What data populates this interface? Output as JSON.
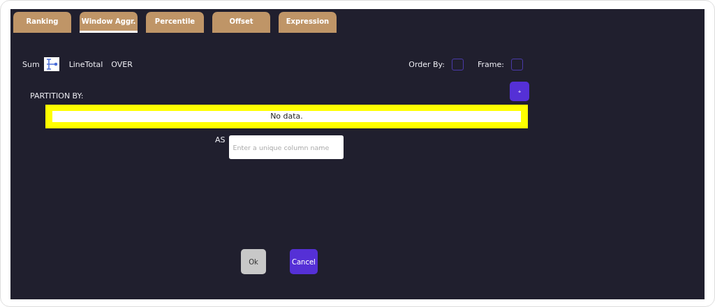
{
  "tabs": [
    {
      "label": "Ranking",
      "selected": false
    },
    {
      "label": "Window Aggr.",
      "selected": true
    },
    {
      "label": "Percentile",
      "selected": false
    },
    {
      "label": "Offset",
      "selected": false
    },
    {
      "label": "Expression",
      "selected": false
    }
  ],
  "function_row": {
    "function": "Sum",
    "column": "LineTotal",
    "keyword": "OVER"
  },
  "options": [
    {
      "label": "Order By:",
      "checked": false
    },
    {
      "label": "Frame:",
      "checked": false
    }
  ],
  "partition": {
    "label": "PARTITION BY:",
    "add_button": "+",
    "empty_text": "No data."
  },
  "alias": {
    "label": "AS",
    "placeholder": "Enter a unique column name"
  },
  "buttons": [
    {
      "label": "Ok",
      "kind": "secondary"
    },
    {
      "label": "Cancel",
      "kind": "primary"
    }
  ]
}
